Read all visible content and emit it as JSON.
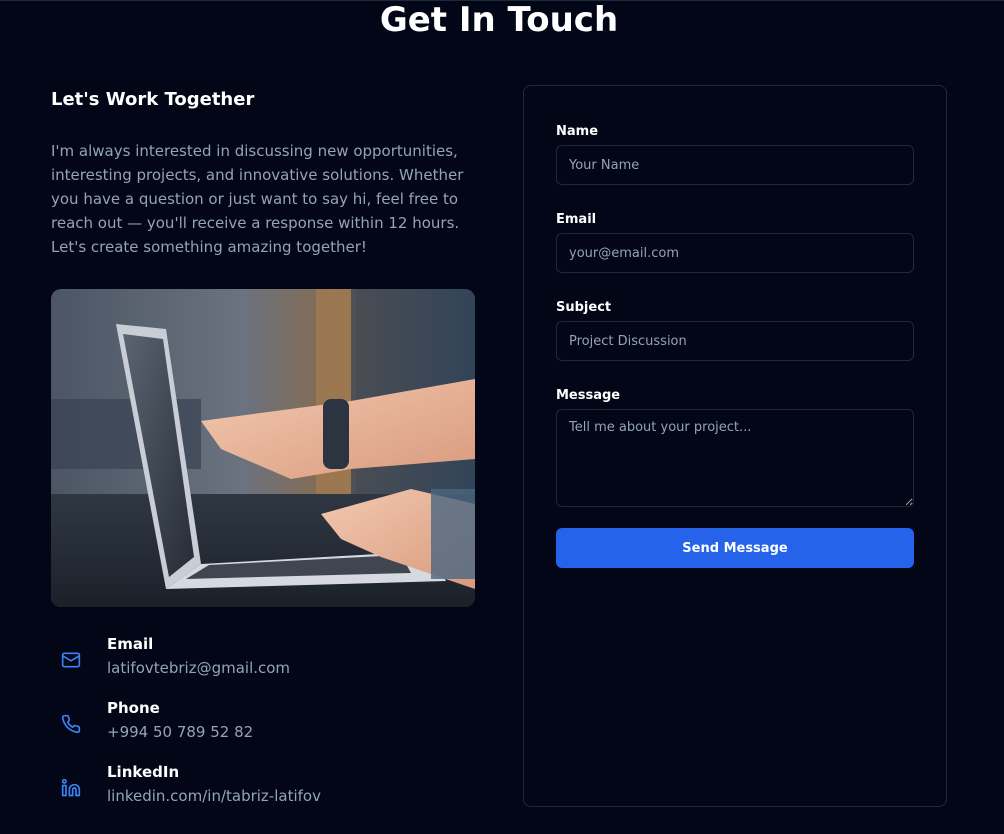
{
  "page": {
    "title": "Get In Touch"
  },
  "intro": {
    "heading": "Let's Work Together",
    "body": "I'm always interested in discussing new opportunities, interesting projects, and innovative solutions. Whether you have a question or just want to say hi, feel free to reach out — you'll receive a response within 12 hours. Let's create something amazing together!"
  },
  "contacts": [
    {
      "icon": "mail-icon",
      "label": "Email",
      "value": "latifovtebriz@gmail.com"
    },
    {
      "icon": "phone-icon",
      "label": "Phone",
      "value": "+994 50 789 52 82"
    },
    {
      "icon": "linkedin-icon",
      "label": "LinkedIn",
      "value": "linkedin.com/in/tabriz-latifov"
    }
  ],
  "form": {
    "name_label": "Name",
    "name_placeholder": "Your Name",
    "email_label": "Email",
    "email_placeholder": "your@email.com",
    "subject_label": "Subject",
    "subject_placeholder": "Project Discussion",
    "message_label": "Message",
    "message_placeholder": "Tell me about your project...",
    "submit_label": "Send Message"
  },
  "colors": {
    "background": "#020617",
    "accent": "#2563eb",
    "icon": "#3b82f6",
    "border": "#1e293b",
    "muted_text": "#94a3b8"
  }
}
